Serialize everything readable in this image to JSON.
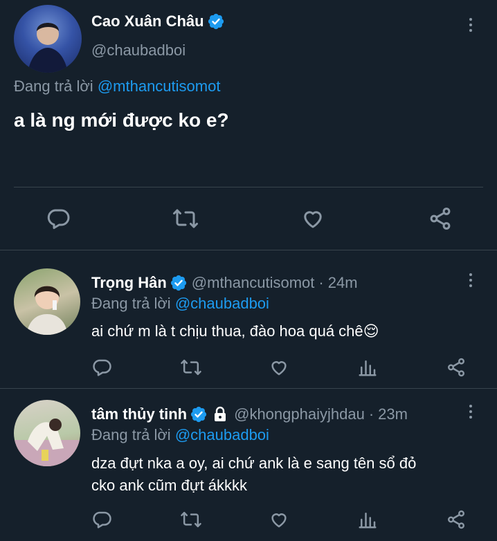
{
  "main_tweet": {
    "display_name": "Cao Xuân Châu",
    "handle": "@chaubadboi",
    "replying_prefix": "Đang trả lời",
    "replying_to": "@mthancutisomot",
    "text": "a là ng mới được ko e?"
  },
  "replies": [
    {
      "display_name": "Trọng Hân",
      "handle": "@mthancutisomot",
      "separator": "·",
      "time": "24m",
      "replying_prefix": "Đang trả lời",
      "replying_to": "@chaubadboi",
      "text": "ai chứ m là t chịu thua, đào hoa quá chê",
      "emoji": "😌"
    },
    {
      "display_name": "tâm thủy tinh",
      "handle": "@khongphaiyjhdau",
      "separator": "·",
      "time": "23m",
      "replying_prefix": "Đang trả lời",
      "replying_to": "@chaubadboi",
      "text_line1": "dza đựt nka a oy, ai chứ ank là e sang tên sổ đỏ",
      "text_line2": "cko ank cũm đựt ákkkk"
    }
  ],
  "colors": {
    "background": "#15202b",
    "accent": "#1d9bf0",
    "muted": "#8b98a5",
    "divider": "#38444d"
  }
}
